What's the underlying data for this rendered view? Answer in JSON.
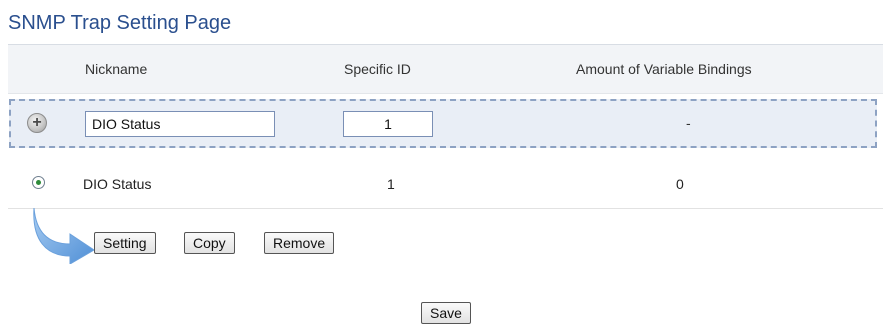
{
  "page": {
    "title": "SNMP Trap Setting Page"
  },
  "table": {
    "headers": {
      "nickname": "Nickname",
      "specific_id": "Specific ID",
      "bindings": "Amount of Variable Bindings"
    }
  },
  "add_row": {
    "nickname_value": "DIO Status",
    "specific_id_value": "1",
    "bindings_value": "-"
  },
  "rows": [
    {
      "nickname": "DIO Status",
      "specific_id": "1",
      "bindings": "0",
      "selected": true
    }
  ],
  "actions": {
    "setting_label": "Setting",
    "copy_label": "Copy",
    "remove_label": "Remove",
    "save_label": "Save"
  },
  "icons": {
    "add": "plus-circle-icon",
    "selector": "radio-selected-icon",
    "action_pointer": "curved-arrow-icon"
  },
  "colors": {
    "title": "#2a4f8e",
    "add_row_bg": "#e9eef6",
    "add_row_border": "#8da2c3",
    "arrow": "#6fa3dd"
  }
}
